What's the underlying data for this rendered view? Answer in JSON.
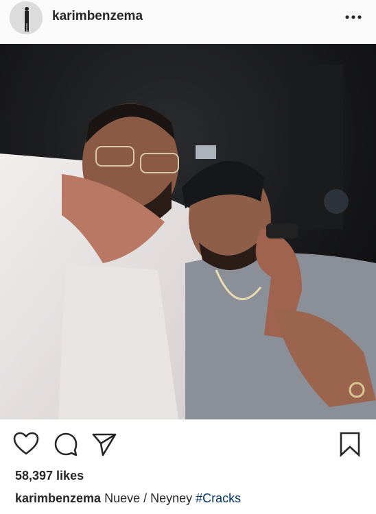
{
  "post": {
    "username": "karimbenzema",
    "likes": "58,397 likes",
    "caption": {
      "username": "karimbenzema",
      "text": " Nueve / Neyney ",
      "hashtag": "#Cracks"
    }
  },
  "icons": {
    "more": "more-options-icon",
    "like": "heart-icon",
    "comment": "comment-icon",
    "share": "paper-plane-icon",
    "save": "bookmark-icon"
  },
  "colors": {
    "text": "#262626",
    "hashtag": "#003569",
    "header_bg": "#fafafa"
  }
}
